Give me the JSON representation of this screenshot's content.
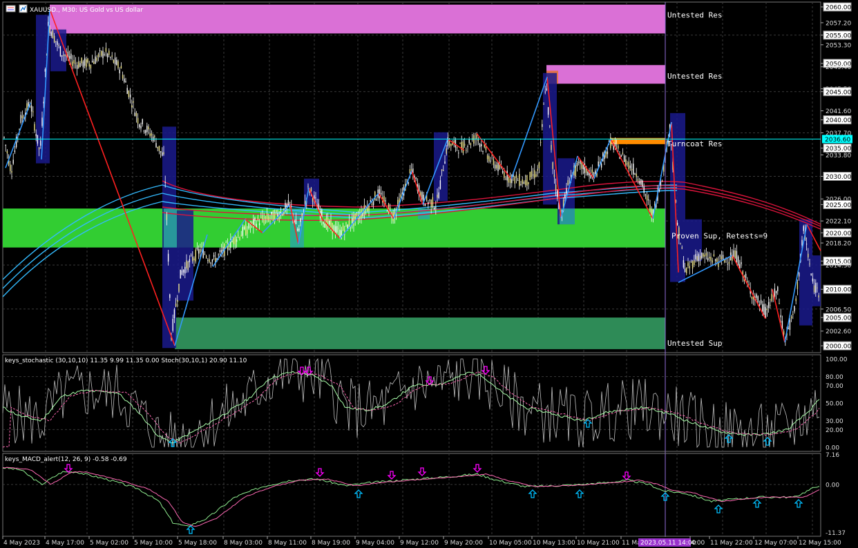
{
  "header": {
    "symbol_title": "XAUUSD., M30: US Gold vs US dollar"
  },
  "colors": {
    "background": "#000000",
    "grid": "#3a3a3a",
    "untested_res": "#da70d6",
    "proven_sup": "#32cd32",
    "untested_sup": "#2e8b57",
    "turncoat": "#ff8c00",
    "price_line": "#00ffff",
    "zigzag_red": "#ff2020",
    "zigzag_blue": "#3399ff",
    "ema_red": "#dc143c",
    "ema_blue": "#33bbff",
    "stoch_main": "#c0c0c0",
    "stoch_signal": "#ff69b4",
    "arrow_up": "#00bfff",
    "arrow_down": "#ff00ff",
    "macd_line": "#90ee90",
    "macd_signal": "#ff69b4"
  },
  "zones": [
    {
      "label": "Untested Res",
      "top": 2060.4,
      "bottom": 2055.3
    },
    {
      "label": "Untested Res",
      "top": 2049.7,
      "bottom": 2046.4
    },
    {
      "label": "Turncoat Res",
      "top": 2036.8,
      "bottom": 2035.7
    },
    {
      "label": "Proven Sup, Retests=9",
      "top": 2024.3,
      "bottom": 2017.4
    },
    {
      "label": "Untested Sup",
      "top": 2005.0,
      "bottom": 1999.4
    }
  ],
  "price_axis": {
    "ticks": [
      "2060.00",
      "2057.20",
      "2055.00",
      "2053.30",
      "2050.00",
      "2049.40",
      "2045.50",
      "2045.00",
      "2041.60",
      "2040.00",
      "2037.70",
      "2035.00",
      "2033.80",
      "2030.00",
      "2026.00",
      "2025.00",
      "2022.10",
      "2020.00",
      "2018.20",
      "2015.00",
      "2014.30",
      "2010.00",
      "2006.50",
      "2005.00",
      "2002.60",
      "2000.00"
    ],
    "boxed": [
      "2060.00",
      "2055.00",
      "2050.00",
      "2045.00",
      "2040.00",
      "2035.00",
      "2030.00",
      "2025.00",
      "2020.00",
      "2015.00",
      "2010.00",
      "2005.00",
      "2000.00"
    ],
    "current_price": "2036.60"
  },
  "stoch": {
    "label": "keys_stochastic (30,10,10) 11.35 9.99 11.35 0.00 Stoch(30,10,1) 20.90 11.10",
    "ticks": [
      "100.00",
      "80.00",
      "70.00",
      "50.00",
      "30.00",
      "20.00",
      "0.00"
    ]
  },
  "macd": {
    "label": "keys_MACD_alert(12, 26, 9) -0.58 -0.69",
    "ticks": [
      "7.16",
      "0.00",
      "-11.37"
    ]
  },
  "time_axis": {
    "labels": [
      "4 May 2023",
      "4 May 17:00",
      "5 May 02:00",
      "5 May 10:00",
      "5 May 18:00",
      "8 May 03:00",
      "8 May 11:00",
      "8 May 19:00",
      "9 May 04:00",
      "9 May 12:00",
      "9 May 20:00",
      "10 May 05:00",
      "10 May 13:00",
      "10 May 21:00",
      "11 Ma",
      "4:00",
      "11 May 22:00",
      "12 May 07:00",
      "12 May 15:00"
    ],
    "highlight": "2023.05.11 14:00"
  }
}
